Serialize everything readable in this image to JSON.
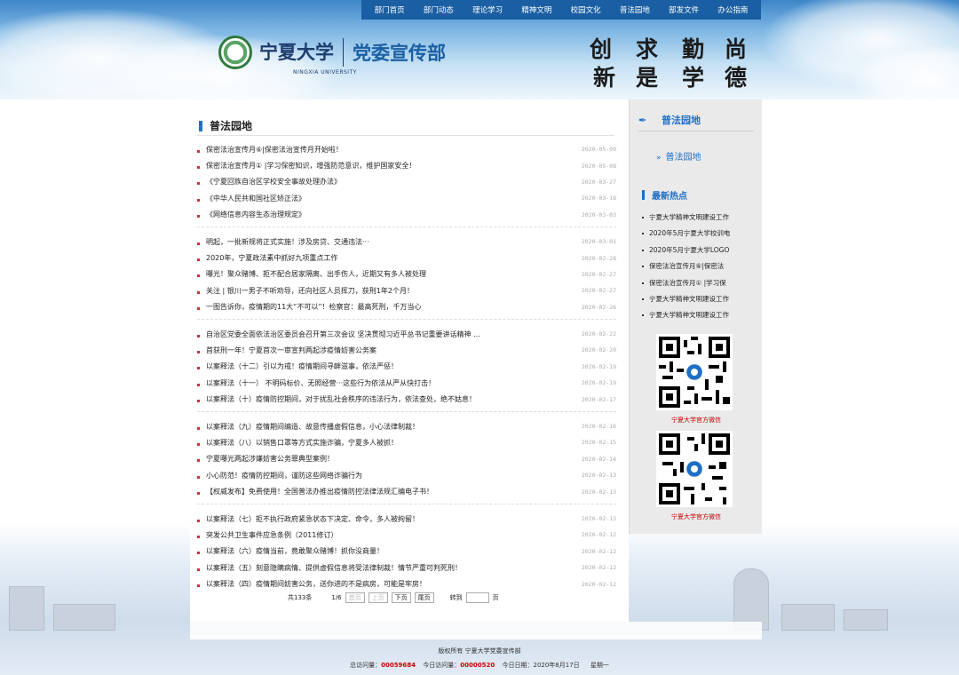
{
  "nav": [
    "部门首页",
    "部门动态",
    "理论学习",
    "精神文明",
    "校园文化",
    "普法园地",
    "部发文件",
    "办公指南"
  ],
  "header": {
    "school_name": "宁夏大学",
    "school_en": "NINGXIA UNIVERSITY",
    "dept_name": "党委宣传部",
    "motto": [
      "创",
      "求",
      "勤",
      "尚",
      "新",
      "是",
      "学",
      "德"
    ]
  },
  "main": {
    "section_title": "普法园地",
    "groups": [
      [
        {
          "title": "保密法治宣传月⑥|保密法治宣传月开始啦！",
          "date": "2020-05-09"
        },
        {
          "title": "保密法治宣传月① |学习保密知识，增强防范意识，维护国家安全！",
          "date": "2020-05-08"
        },
        {
          "title": "《宁夏回族自治区学校安全事故处理办法》",
          "date": "2020-03-27"
        },
        {
          "title": "《中华人民共和国社区矫正法》",
          "date": "2020-03-18"
        },
        {
          "title": "《网络信息内容生态治理规定》",
          "date": "2020-03-03"
        }
      ],
      [
        {
          "title": "明起，一批新规将正式实施！涉及房贷、交通违法···",
          "date": "2020-03-01"
        },
        {
          "title": "2020年，宁夏政法素中抓好九项重点工作",
          "date": "2020-02-28"
        },
        {
          "title": "曝光！聚众赌博、拒不配合居家隔离、出手伤人，近期又有多人被处理",
          "date": "2020-02-27"
        },
        {
          "title": "关注 | 银川一男子不听劝导，还向社区人员挥刀，获刑1年2个月！",
          "date": "2020-02-27"
        },
        {
          "title": "一图告诉你，疫情期的11大“不可以”！检察官：最高死刑，千万当心",
          "date": "2020-02-26"
        }
      ],
      [
        {
          "title": "自治区党委全面依法治区委员会召开第三次会议 坚决贯彻习近平总书记重要讲话精神 ...",
          "date": "2020-02-22"
        },
        {
          "title": "首获刑一年！宁夏首次一审宣判两起涉疫情妨害公务案",
          "date": "2020-02-20"
        },
        {
          "title": "以案释法（十二）引以为戒！疫情期间寻衅滋事，依法严惩！",
          "date": "2020-02-19"
        },
        {
          "title": "以案释法（十一） 不明码标价、无照经营···这些行为依法从严从快打击！",
          "date": "2020-02-19"
        },
        {
          "title": "以案释法（十）疫情防控期间，对于扰乱社会秩序的违法行为，依法查处，绝不姑息！",
          "date": "2020-02-17"
        }
      ],
      [
        {
          "title": "以案释法（九）疫情期间编造、故意传播虚假信息，小心法律制裁！",
          "date": "2020-02-16"
        },
        {
          "title": "以案释法（八）以销售口罩等方式实施诈骗，宁夏多人被抓！",
          "date": "2020-02-15"
        },
        {
          "title": "宁夏曝光两起涉嫌妨害公务罪典型案例！",
          "date": "2020-02-14"
        },
        {
          "title": "小心防范！疫情防控期间，谨防这些网络诈骗行为",
          "date": "2020-02-13"
        },
        {
          "title": "【权威发布】免费使用！全国普法办推出疫情防控法律法规汇编电子书！",
          "date": "2020-02-13"
        }
      ],
      [
        {
          "title": "以案释法（七）拒不执行政府紧急状态下决定、命令，多人被拘留！",
          "date": "2020-02-13"
        },
        {
          "title": "突发公共卫生事件应急条例（2011修订）",
          "date": "2020-02-12"
        },
        {
          "title": "以案释法（六）疫情当前，竟敢聚众赌博！抓你没商量！",
          "date": "2020-02-12"
        },
        {
          "title": "以案释法（五）刻意隐瞒病情、提供虚假信息将受法律制裁！情节严重可判死刑！",
          "date": "2020-02-12"
        },
        {
          "title": "以案释法（四）疫情期间妨害公务，送你进的不是病房，可能是牢房！",
          "date": "2020-02-12"
        }
      ]
    ],
    "pager": {
      "total": "共133条",
      "page": "1/6",
      "first": "首页",
      "prev": "上页",
      "next": "下页",
      "last": "尾页",
      "goto": "转到",
      "page_unit": "页"
    }
  },
  "side": {
    "section_title": "普法园地",
    "link": "普法园地",
    "hot_title": "最新热点",
    "hot": [
      "宁夏大学精神文明建设工作",
      "2020年5月宁夏大学校训电",
      "2020年5月宁夏大学LOGO",
      "保密法治宣传月⑥|保密法",
      "保密法治宣传月① |学习保",
      "宁夏大学精神文明建设工作",
      "宁夏大学精神文明建设工作"
    ],
    "qr_caption_1": "宁夏大学官方微信",
    "qr_caption_2": "宁夏大学官方微信"
  },
  "footer": {
    "copyright": "版权所有  宁夏大学党委宣传部",
    "visits_label": "总访问量：",
    "visits": "00059684",
    "today_label": "今日访问量：",
    "today": "00000520",
    "date_label": "今日日期：",
    "date": "2020年8月17日",
    "weekday": "星期一"
  }
}
